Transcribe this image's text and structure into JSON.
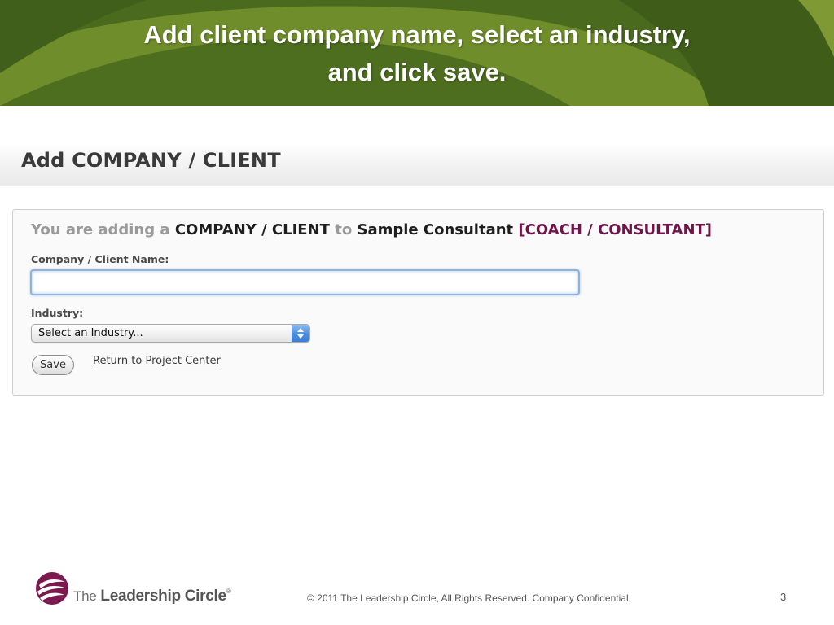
{
  "banner": {
    "title_line1": "Add client company name, select an industry,",
    "title_line2": "and click save.",
    "colors": {
      "dark_green": "#3d5a1a",
      "mid_green": "#5e7f24",
      "light_green": "#7a952e"
    }
  },
  "page": {
    "title": "Add COMPANY / CLIENT"
  },
  "form": {
    "context": {
      "prefix": "You are adding a",
      "entity": "COMPANY / CLIENT",
      "connector": "to",
      "consultant": "Sample Consultant",
      "role": "[COACH / CONSULTANT]"
    },
    "name_label": "Company / Client Name:",
    "name_value": "",
    "industry_label": "Industry:",
    "industry_selected": "Select an Industry...",
    "save_label": "Save",
    "return_link": "Return to Project Center"
  },
  "footer": {
    "logo_the": "The",
    "logo_name_1": "Leadership",
    "logo_name_2": "Circle",
    "logo_reg": "®",
    "copyright": "© 2011 The Leadership Circle, All Rights Reserved. Company Confidential",
    "page_number": "3"
  },
  "colors": {
    "accent_role": "#6e1549",
    "logo_purple": "#7a1a4f",
    "input_focus": "#8fb2d9"
  }
}
